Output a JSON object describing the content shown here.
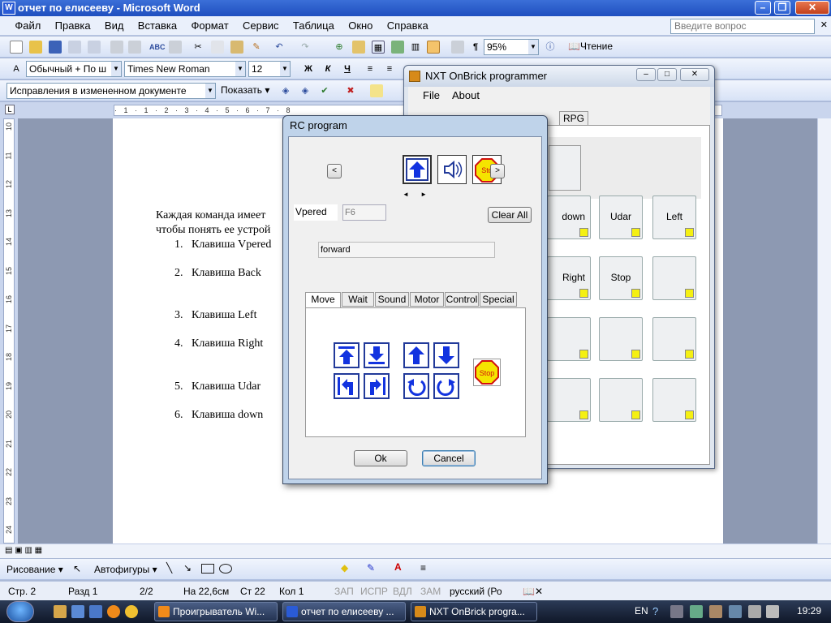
{
  "word": {
    "title": "отчет по елисееву - Microsoft Word",
    "menu": [
      "Файл",
      "Правка",
      "Вид",
      "Вставка",
      "Формат",
      "Сервис",
      "Таблица",
      "Окно",
      "Справка"
    ],
    "ask_placeholder": "Введите вопрос",
    "zoom": "95%",
    "read_label": "Чтение",
    "style": "Обычный + По ш",
    "font": "Times New Roman",
    "size": "12",
    "bold": "Ж",
    "italic": "К",
    "underline": "Ч",
    "track_changes": "Исправления в измененном документе",
    "show_label": "Показать",
    "ruler_label": "· 1 · 1 · 2 · 3 · 4 · 5 · 6 · 7 · 8",
    "vruler": [
      "10",
      "11",
      "12",
      "13",
      "14",
      "15",
      "16",
      "17",
      "18",
      "19",
      "20",
      "21",
      "22",
      "23",
      "24"
    ],
    "para1a": "Каждая команда имеет",
    "para1b": "чтобы понять ее устрой",
    "list": [
      {
        "num": "1.",
        "text": "Клавиша Vpered"
      },
      {
        "num": "2.",
        "text": "Клавиша Back"
      },
      {
        "num": "3.",
        "text": "Клавиша Left"
      },
      {
        "num": "4.",
        "text": "Клавиша Right"
      },
      {
        "num": "5.",
        "text": "Клавиша Udar"
      },
      {
        "num": "6.",
        "text": "Клавиша down"
      }
    ],
    "draw_label": "Рисование",
    "autoshapes_label": "Автофигуры",
    "status": {
      "page": "Стр. 2",
      "section": "Разд 1",
      "pages": "2/2",
      "at": "На 22,6см",
      "line": "Ст 22",
      "col": "Кол 1",
      "rec": "ЗАП",
      "trk": "ИСПР",
      "ext": "ВДЛ",
      "ovr": "ЗАМ",
      "lang": "русский (Ро"
    }
  },
  "nxt": {
    "title": "NXT OnBrick programmer",
    "menu": [
      "File",
      "About"
    ],
    "tab_visible": "RPG",
    "tiles": [
      {
        "label": "down"
      },
      {
        "label": "Udar"
      },
      {
        "label": "Left"
      },
      {
        "label": "Right"
      },
      {
        "label": "Stop"
      },
      {
        "label": ""
      },
      {
        "label": ""
      },
      {
        "label": ""
      },
      {
        "label": ""
      },
      {
        "label": ""
      },
      {
        "label": ""
      },
      {
        "label": ""
      }
    ]
  },
  "rc": {
    "title": "RC program",
    "left_arrow": "<",
    "right_arrow": ">",
    "stop_short": "Sto",
    "small_arrows": "◄ ►",
    "name_value": "Vpered",
    "key_value": "F6",
    "clear_all": "Clear All",
    "command_name": "forward",
    "tabs": [
      "Move",
      "Wait",
      "Sound",
      "Motor",
      "Control",
      "Special"
    ],
    "stop_label": "Stop",
    "ok": "Ok",
    "cancel": "Cancel"
  },
  "taskbar": {
    "buttons": [
      "Проигрыватель Wi...",
      "отчет по елисееву ...",
      "NXT OnBrick progra..."
    ],
    "lang": "EN",
    "time": "19:29"
  }
}
